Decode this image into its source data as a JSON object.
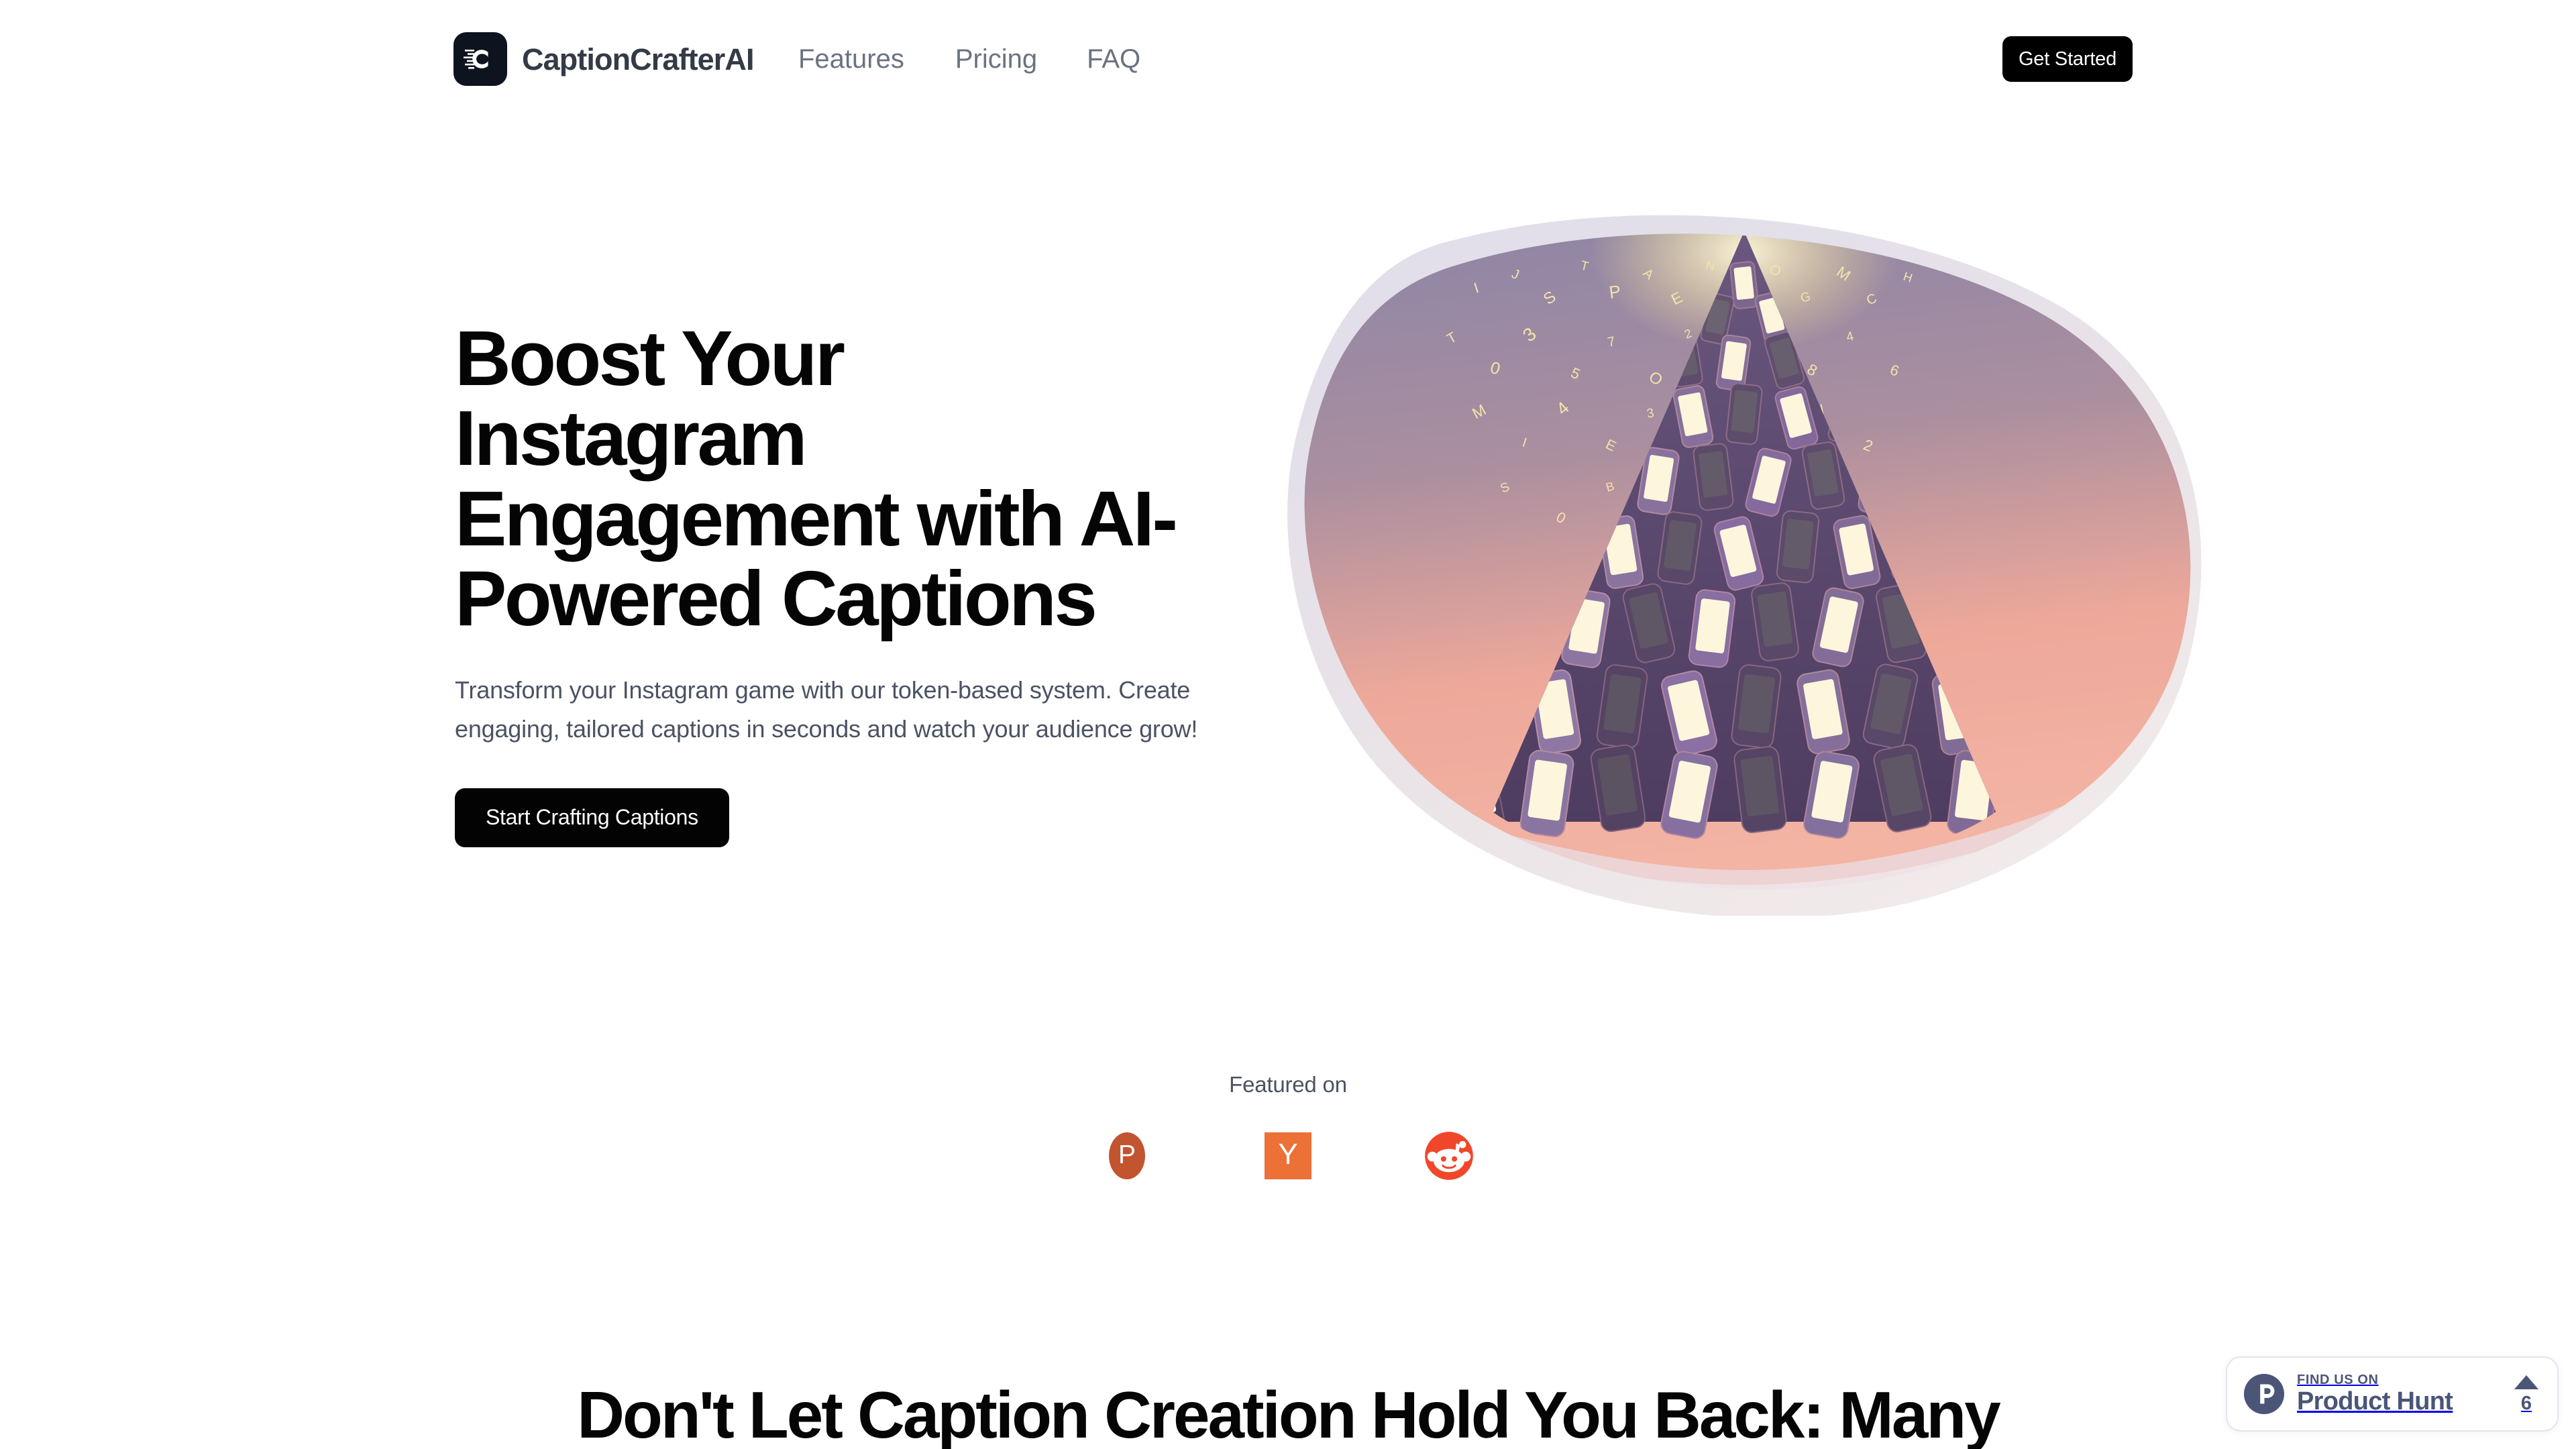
{
  "brand": {
    "name": "CaptionCrafterAI",
    "logo_icon": "caption-c-logo-icon",
    "logo_bg": "#0d1420"
  },
  "nav": {
    "links": [
      {
        "label": "Features",
        "name": "nav-link-features"
      },
      {
        "label": "Pricing",
        "name": "nav-link-pricing"
      },
      {
        "label": "FAQ",
        "name": "nav-link-faq"
      }
    ],
    "cta_label": "Get Started"
  },
  "hero": {
    "title": "Boost Your Instagram Engagement with AI-Powered Captions",
    "subtitle": "Transform your Instagram game with our token-based system. Create engaging, tailored captions in seconds and watch your audience grow!",
    "cta_label": "Start Crafting Captions",
    "illustration": {
      "name": "phone-pyramid-illustration",
      "description": "Pyramid of purple smartphones with glowing screens, golden letters rising from the peak, on a pink-to-purple gradient blob",
      "blob_outer_color": "#ddd8e4",
      "blob_inner_top_color": "#8d85a6",
      "blob_inner_bottom_color": "#f0a89c",
      "phone_body_color": "#5e4a72",
      "phone_screen_color": "#fdf6dc",
      "letters_color": "#f2e2a8"
    }
  },
  "featured": {
    "label": "Featured on",
    "logos": [
      {
        "name": "product-hunt-badge",
        "glyph": "P",
        "color": "#c2552f",
        "shape": "circle"
      },
      {
        "name": "hacker-news-badge",
        "glyph": "Y",
        "color": "#ec7137",
        "shape": "square"
      },
      {
        "name": "reddit-badge",
        "glyph": "snoo",
        "color": "#f0472a",
        "shape": "circle"
      }
    ]
  },
  "section": {
    "heading": "Don't Let Caption Creation Hold You Back: Many"
  },
  "product_hunt_widget": {
    "kicker": "FIND US ON",
    "title": "Product Hunt",
    "vote_count": "6",
    "accent_color": "#4a5578"
  }
}
